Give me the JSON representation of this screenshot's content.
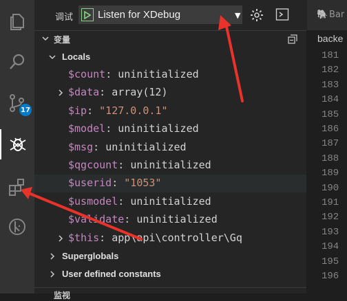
{
  "activity_bar": {
    "scm_badge": "17",
    "icons": [
      "files-icon",
      "search-icon",
      "source-control-icon",
      "debug-icon",
      "extensions-icon",
      "remote-icon"
    ]
  },
  "debug": {
    "label": "调试",
    "config_name": "Listen for XDebug",
    "dropdown_glyph": "▼"
  },
  "variables_section": {
    "title": "变量"
  },
  "scopes": [
    {
      "name": "Locals",
      "expanded": true
    },
    {
      "name": "Superglobals",
      "expanded": false
    },
    {
      "name": "User defined constants",
      "expanded": false
    }
  ],
  "locals": [
    {
      "name": "$count",
      "value": "uninitialized",
      "expandable": false
    },
    {
      "name": "$data",
      "value": "array(12)",
      "expandable": true
    },
    {
      "name": "$ip",
      "value": "\"127.0.0.1\"",
      "expandable": false
    },
    {
      "name": "$model",
      "value": "uninitialized",
      "expandable": false
    },
    {
      "name": "$msg",
      "value": "uninitialized",
      "expandable": false
    },
    {
      "name": "$qgcount",
      "value": "uninitialized",
      "expandable": false
    },
    {
      "name": "$userid",
      "value": "\"1053\"",
      "expandable": false
    },
    {
      "name": "$usmodel",
      "value": "uninitialized",
      "expandable": false
    },
    {
      "name": "$validate",
      "value": "uninitialized",
      "expandable": false
    },
    {
      "name": "$this",
      "value": "app\\api\\controller\\Gq",
      "expandable": true
    }
  ],
  "bottom_section": {
    "title": "监视"
  },
  "editor": {
    "tab_label": "Bar",
    "breadcrumb": "backe",
    "line_numbers": [
      "181",
      "182",
      "183",
      "184",
      "185",
      "186",
      "187",
      "188",
      "189",
      "190",
      "191",
      "192",
      "193",
      "194",
      "195",
      "196"
    ]
  },
  "colors": {
    "accent": "#007acc",
    "annotation_arrow": "#e8332a",
    "var_name": "#c586c0",
    "string_value": "#ce9178"
  }
}
